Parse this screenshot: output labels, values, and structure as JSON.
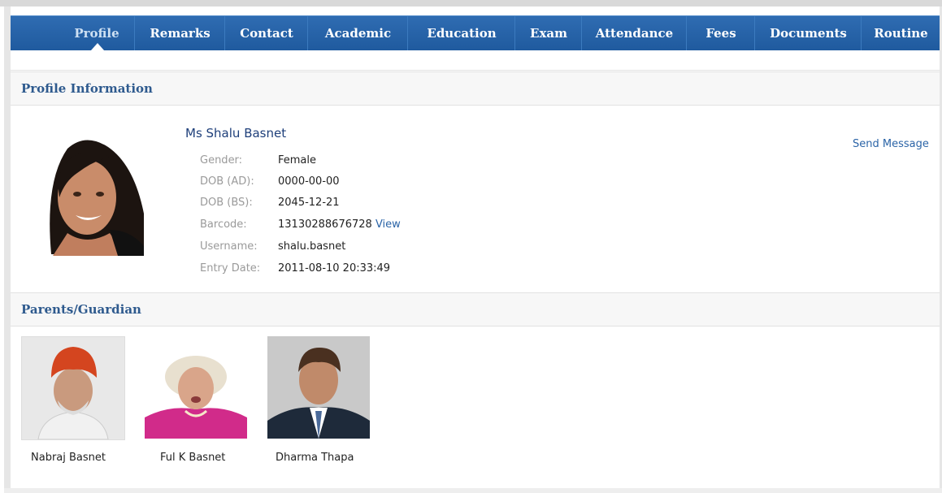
{
  "nav": {
    "tabs": [
      {
        "label": "Profile",
        "active": true
      },
      {
        "label": "Remarks",
        "active": false
      },
      {
        "label": "Contact",
        "active": false
      },
      {
        "label": "Academic",
        "active": false
      },
      {
        "label": "Education",
        "active": false
      },
      {
        "label": "Exam",
        "active": false
      },
      {
        "label": "Attendance",
        "active": false
      },
      {
        "label": "Fees",
        "active": false
      },
      {
        "label": "Documents",
        "active": false
      },
      {
        "label": "Routine",
        "active": false
      }
    ]
  },
  "profile": {
    "section_title": "Profile Information",
    "name": "Ms Shalu Basnet",
    "send_message": "Send Message",
    "fields": [
      {
        "label": "Gender:",
        "value": "Female"
      },
      {
        "label": "DOB (AD):",
        "value": "0000-00-00"
      },
      {
        "label": "DOB (BS):",
        "value": "2045-12-21"
      },
      {
        "label": "Barcode:",
        "value": "13130288676728"
      },
      {
        "label": "Username:",
        "value": "shalu.basnet"
      },
      {
        "label": "Entry Date:",
        "value": "2011-08-10 20:33:49"
      }
    ],
    "barcode_view_link": "View"
  },
  "parents": {
    "section_title": "Parents/Guardian",
    "items": [
      {
        "name": "Nabraj Basnet"
      },
      {
        "name": "Ful K Basnet"
      },
      {
        "name": "Dharma Thapa"
      }
    ]
  },
  "colors": {
    "nav_bg": "#2a65a8",
    "heading": "#2e5a8e",
    "link": "#2b64a7"
  }
}
